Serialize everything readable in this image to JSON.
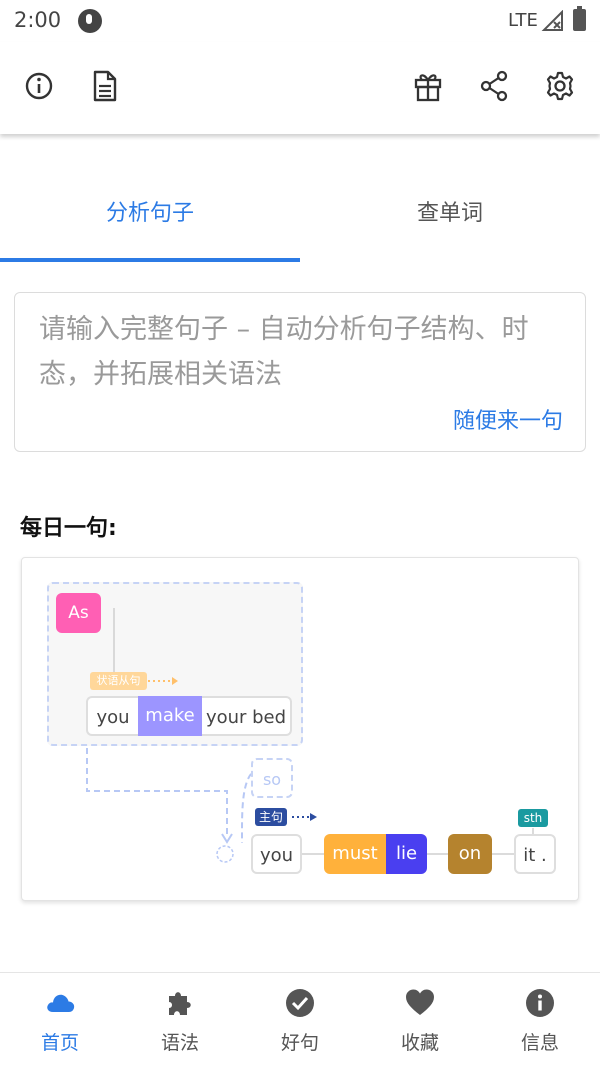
{
  "status_bar": {
    "time": "2:00",
    "network": "LTE"
  },
  "toolbar": {
    "left_icons": [
      "info-icon",
      "document-icon"
    ],
    "right_icons": [
      "gift-icon",
      "share-icon",
      "settings-icon"
    ]
  },
  "tabs": [
    {
      "label": "分析句子",
      "active": true
    },
    {
      "label": "查单词",
      "active": false
    }
  ],
  "input": {
    "placeholder": "请输入完整句子 – 自动分析句子结构、时态，并拓展相关语法",
    "random_link": "随便来一句"
  },
  "daily": {
    "title": "每日一句:",
    "diagram": {
      "conjunction": "As",
      "clause_tag": "状语从句",
      "clause_words": [
        "you",
        "make",
        "your bed"
      ],
      "connector": "so",
      "main_tag": "主句",
      "main_words": [
        "you",
        "must",
        "lie",
        "on",
        "it ."
      ],
      "object_tag": "sth"
    }
  },
  "bottom_nav": [
    {
      "label": "首页",
      "icon": "cloud-icon",
      "active": true
    },
    {
      "label": "语法",
      "icon": "puzzle-icon",
      "active": false
    },
    {
      "label": "好句",
      "icon": "check-circle-icon",
      "active": false
    },
    {
      "label": "收藏",
      "icon": "heart-icon",
      "active": false
    },
    {
      "label": "信息",
      "icon": "info-circle-icon",
      "active": false
    }
  ],
  "colors": {
    "accent": "#2c7be5",
    "conjunction_pink": "#ff5fb4",
    "verb_purple": "#9c95ff",
    "modal_orange": "#ffb13b",
    "verb_blue": "#4a3ff0",
    "prep_brown": "#b5832e",
    "tag_teal": "#1a9aa0",
    "tag_navy": "#2c4da0",
    "tag_orange_light": "#ffd79a"
  }
}
